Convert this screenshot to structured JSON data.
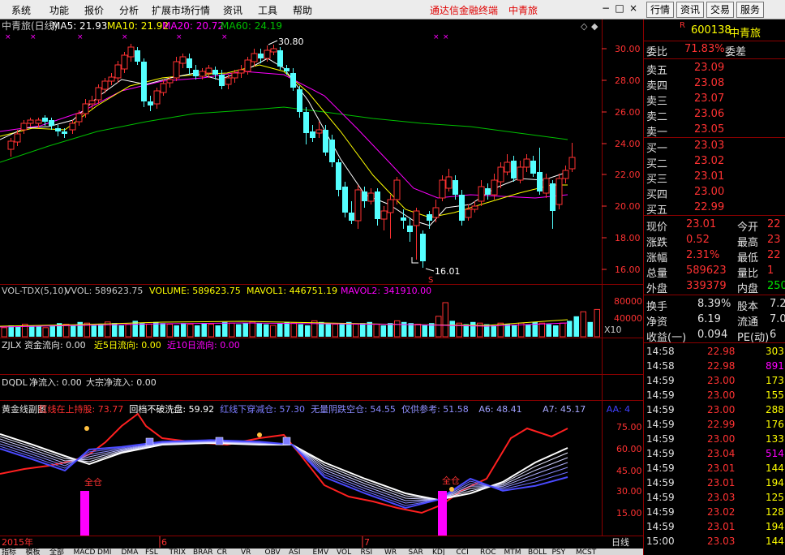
{
  "menubar": {
    "items": [
      "系统",
      "功能",
      "报价",
      "分析",
      "扩展市场行情",
      "资讯",
      "工具",
      "帮助"
    ],
    "brand": "通达信金融终端",
    "brand_stock": "中青旅",
    "right_buttons": [
      "行情",
      "资讯",
      "交易",
      "服务"
    ],
    "window_controls": [
      "−",
      "□",
      "×"
    ]
  },
  "main_chart": {
    "title": "中青旅(日线)",
    "ma5": "MA5: 21.93",
    "ma10": "MA10: 21.92",
    "ma20": "MA20: 20.72",
    "ma60": "MA60: 24.19",
    "high_label": "30.80",
    "low_label": "16.01",
    "low_marker": "S",
    "ylabels": [
      "30.00",
      "28.00",
      "26.00",
      "24.00",
      "22.00",
      "20.00",
      "18.00",
      "16.00"
    ]
  },
  "volume_panel": {
    "title": "VOL-TDX(5,10)",
    "vvol": "VVOL: 589623.75",
    "volume": "VOLUME: 589623.75",
    "mavol1": "MAVOL1: 446751.19",
    "mavol2": "MAVOL2: 341910.00",
    "ylabels": [
      "80000",
      "40000"
    ],
    "unit": "X10"
  },
  "flow_panel": {
    "label1": "ZJLX 资金流向: 0.00",
    "label2": "近5日流向: 0.00",
    "label3": "近10日流向: 0.00"
  },
  "ddx_panel": {
    "label1": "DQDL",
    "label2": "净流入: 0.00",
    "label3": "大宗净流入: 0.00"
  },
  "indicator_panel": {
    "labels": [
      {
        "text": "黄金线副图",
        "color": "#e0e0e0"
      },
      {
        "text": "红线在上持股: 73.77",
        "color": "#ff3030"
      },
      {
        "text": "回档不破洗盘: 59.92",
        "color": "#ffffff"
      },
      {
        "text": "红线下穿减仓: 57.30",
        "color": "#7c7cff"
      },
      {
        "text": "无量阴跌空仓: 54.55",
        "color": "#8a8aff"
      },
      {
        "text": "仅供参考: 51.58",
        "color": "#9090ff"
      },
      {
        "text": "A6: 48.41",
        "color": "#a0a0ff"
      },
      {
        "text": "A7: 45.17",
        "color": "#a8a8ff"
      },
      {
        "text": "AA: 4",
        "color": "#4040ff"
      }
    ],
    "ylabels": [
      "75.00",
      "60.00",
      "45.00",
      "30.00",
      "15.00"
    ],
    "signal1": "全仓",
    "signal2": "全仓"
  },
  "time_axis": {
    "year": "2015年",
    "month6": "6",
    "month7": "7",
    "period": "日线"
  },
  "tabs": [
    "指标",
    "模板",
    "全部",
    "MACD",
    "DMI",
    "DMA",
    "FSL",
    "TRIX",
    "BRAR",
    "CR",
    "VR",
    "OBV",
    "ASI",
    "EMV",
    "VOL",
    "RSI",
    "WR",
    "SAR",
    "KDJ",
    "CCI",
    "ROC",
    "MTM",
    "BOLL",
    "PSY",
    "MCST"
  ],
  "quote": {
    "badge": "R",
    "code": "600138",
    "name": "中青旅",
    "weibi_label": "委比",
    "weibi": "71.83%",
    "weicha_label": "委差",
    "asks": [
      {
        "label": "卖五",
        "price": "23.09"
      },
      {
        "label": "卖四",
        "price": "23.08"
      },
      {
        "label": "卖三",
        "price": "23.07"
      },
      {
        "label": "卖二",
        "price": "23.06"
      },
      {
        "label": "卖一",
        "price": "23.05"
      }
    ],
    "bids": [
      {
        "label": "买一",
        "price": "23.03"
      },
      {
        "label": "买二",
        "price": "23.02"
      },
      {
        "label": "买三",
        "price": "23.01"
      },
      {
        "label": "买四",
        "price": "23.00"
      },
      {
        "label": "买五",
        "price": "22.99"
      }
    ],
    "stats": [
      {
        "l1": "现价",
        "v1": "23.01",
        "l2": "今开",
        "v2": "22"
      },
      {
        "l1": "涨跌",
        "v1": "0.52",
        "l2": "最高",
        "v2": "23"
      },
      {
        "l1": "涨幅",
        "v1": "2.31%",
        "l2": "最低",
        "v2": "22"
      },
      {
        "l1": "总量",
        "v1": "589623",
        "l2": "量比",
        "v2": "1"
      },
      {
        "l1": "外盘",
        "v1": "339379",
        "l2": "内盘",
        "v2": "250"
      }
    ],
    "fund": [
      {
        "l1": "换手",
        "v1": "8.39%",
        "l2": "股本",
        "v2": "7.2"
      },
      {
        "l1": "净资",
        "v1": "6.19",
        "l2": "流通",
        "v2": "7.0"
      },
      {
        "l1": "收益(一)",
        "v1": "0.094",
        "l2": "PE(动)",
        "v2": "6"
      }
    ],
    "ticks": [
      {
        "time": "14:58",
        "price": "22.98",
        "vol": "303"
      },
      {
        "time": "14:58",
        "price": "22.98",
        "vol": "891"
      },
      {
        "time": "14:59",
        "price": "23.00",
        "vol": "173"
      },
      {
        "time": "14:59",
        "price": "23.00",
        "vol": "155"
      },
      {
        "time": "14:59",
        "price": "23.00",
        "vol": "288"
      },
      {
        "time": "14:59",
        "price": "22.99",
        "vol": "176"
      },
      {
        "time": "14:59",
        "price": "23.00",
        "vol": "133"
      },
      {
        "time": "14:59",
        "price": "23.04",
        "vol": "514"
      },
      {
        "time": "14:59",
        "price": "23.01",
        "vol": "144"
      },
      {
        "time": "14:59",
        "price": "23.01",
        "vol": "194"
      },
      {
        "time": "14:59",
        "price": "23.03",
        "vol": "125"
      },
      {
        "time": "14:59",
        "price": "23.02",
        "vol": "128"
      },
      {
        "time": "14:59",
        "price": "23.01",
        "vol": "194"
      },
      {
        "time": "15:00",
        "price": "23.03",
        "vol": "144"
      }
    ]
  },
  "colors": {
    "up": "#ff3232",
    "down": "#54ffff",
    "ma5": "#ffffff",
    "ma10": "#ffff00",
    "ma20": "#ff00ff",
    "ma60": "#00c000",
    "grid": "#8b0000"
  }
}
